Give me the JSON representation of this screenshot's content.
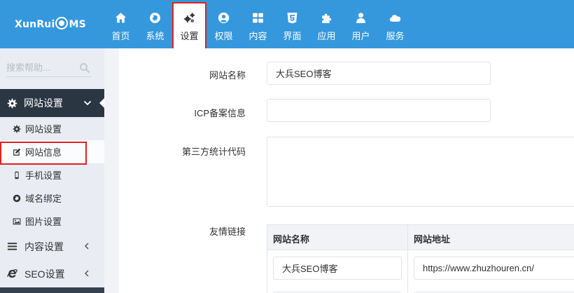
{
  "header": {
    "logo": {
      "pre": "XunRui",
      "post": "MS"
    },
    "nav": [
      {
        "label": "首页",
        "icon": "home-icon"
      },
      {
        "label": "系统",
        "icon": "globe-icon"
      },
      {
        "label": "设置",
        "icon": "cogs-icon",
        "active": true
      },
      {
        "label": "权限",
        "icon": "user-circle-icon"
      },
      {
        "label": "内容",
        "icon": "grid-icon"
      },
      {
        "label": "界面",
        "icon": "html5-icon"
      },
      {
        "label": "应用",
        "icon": "puzzle-icon"
      },
      {
        "label": "用户",
        "icon": "user-icon"
      },
      {
        "label": "服务",
        "icon": "cloud-icon"
      }
    ]
  },
  "sidebar": {
    "search_placeholder": "搜索帮助...",
    "main_menu": {
      "label": "网站设置"
    },
    "sub_items": [
      {
        "label": "网站设置",
        "icon": "cog-icon"
      },
      {
        "label": "网站信息",
        "icon": "edit-icon",
        "active": true
      },
      {
        "label": "手机设置",
        "icon": "mobile-icon"
      },
      {
        "label": "域名绑定",
        "icon": "globe-icon"
      },
      {
        "label": "图片设置",
        "icon": "image-icon"
      }
    ],
    "groups": [
      {
        "label": "内容设置",
        "icon": "list-icon"
      },
      {
        "label": "SEO设置",
        "icon": "internet-explorer-icon"
      }
    ]
  },
  "form": {
    "site_name_label": "网站名称",
    "site_name_value": "大兵SEO博客",
    "icp_label": "ICP备案信息",
    "icp_value": "",
    "stats_label": "第三方统计代码",
    "links_label": "友情链接",
    "links_table": {
      "col_name": "网站名称",
      "col_url": "网站地址",
      "rows": [
        {
          "name": "大兵SEO博客",
          "url": "https://www.zhuzhouren.cn/"
        }
      ]
    }
  },
  "colors": {
    "header_bg": "#3598dc",
    "sidebar_dark": "#364150",
    "highlight_border": "#e02222"
  }
}
